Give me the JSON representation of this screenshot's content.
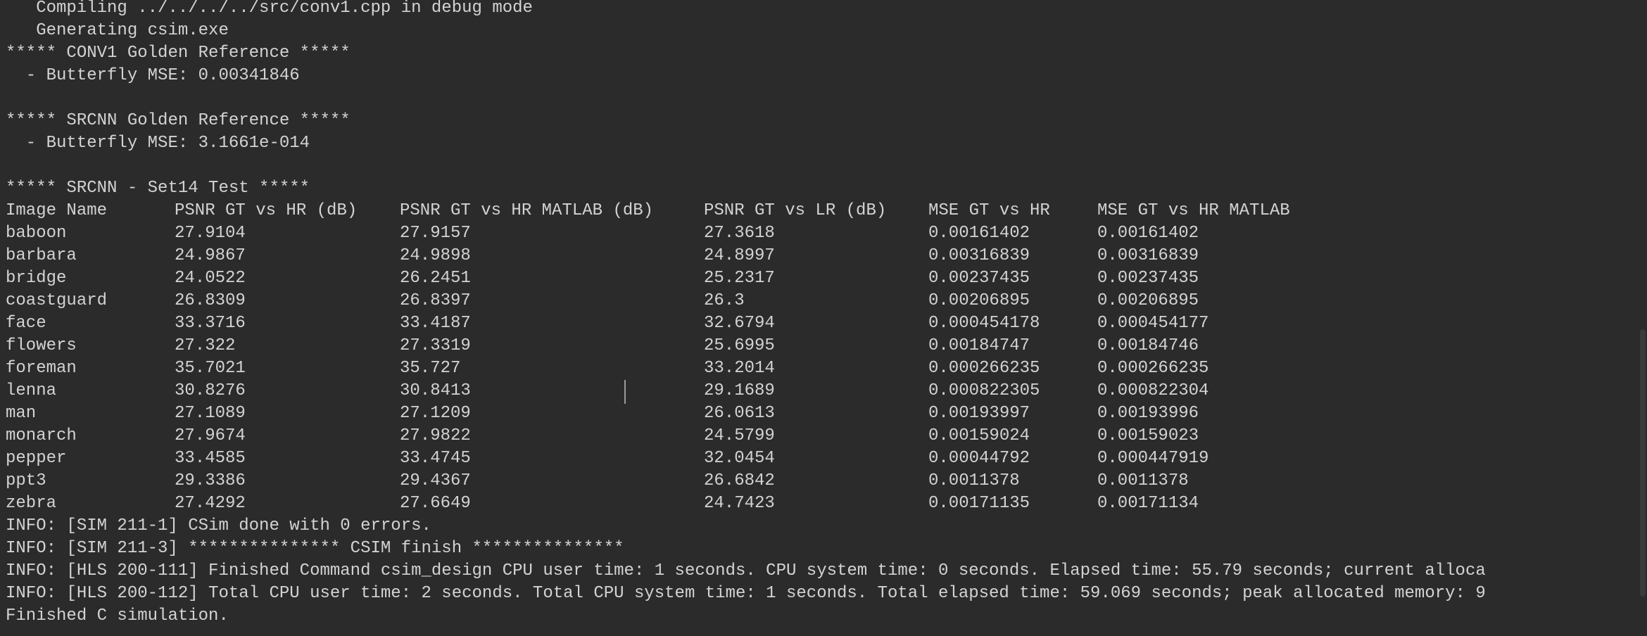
{
  "console": {
    "lines_top": [
      "   Compiling ../../../../src/conv1.cpp in debug mode",
      "   Generating csim.exe",
      "***** CONV1 Golden Reference *****",
      "  - Butterfly MSE: 0.00341846",
      "",
      "***** SRCNN Golden Reference *****",
      "  - Butterfly MSE: 3.1661e-014",
      "",
      "***** SRCNN - Set14 Test *****"
    ],
    "table": {
      "headers": [
        "Image Name",
        "PSNR GT vs HR (dB)",
        "PSNR GT vs HR MATLAB (dB)",
        "PSNR GT vs LR (dB)",
        "MSE GT vs HR",
        "MSE GT vs HR MATLAB"
      ],
      "rows": [
        [
          "baboon",
          "27.9104",
          "27.9157",
          "27.3618",
          "0.00161402",
          "0.00161402"
        ],
        [
          "barbara",
          "24.9867",
          "24.9898",
          "24.8997",
          "0.00316839",
          "0.00316839"
        ],
        [
          "bridge",
          "24.0522",
          "26.2451",
          "25.2317",
          "0.00237435",
          "0.00237435"
        ],
        [
          "coastguard",
          "26.8309",
          "26.8397",
          "26.3",
          "0.00206895",
          "0.00206895"
        ],
        [
          "face",
          "33.3716",
          "33.4187",
          "32.6794",
          "0.000454178",
          "0.000454177"
        ],
        [
          "flowers",
          "27.322",
          "27.3319",
          "25.6995",
          "0.00184747",
          "0.00184746"
        ],
        [
          "foreman",
          "35.7021",
          "35.727",
          "33.2014",
          "0.000266235",
          "0.000266235"
        ],
        [
          "lenna",
          "30.8276",
          "30.8413",
          "29.1689",
          "0.000822305",
          "0.000822304"
        ],
        [
          "man",
          "27.1089",
          "27.1209",
          "26.0613",
          "0.00193997",
          "0.00193996"
        ],
        [
          "monarch",
          "27.9674",
          "27.9822",
          "24.5799",
          "0.00159024",
          "0.00159023"
        ],
        [
          "pepper",
          "33.4585",
          "33.4745",
          "32.0454",
          "0.00044792",
          "0.000447919"
        ],
        [
          "ppt3",
          "29.3386",
          "29.4367",
          "26.6842",
          "0.0011378",
          "0.0011378"
        ],
        [
          "zebra",
          "27.4292",
          "27.6649",
          "24.7423",
          "0.00171135",
          "0.00171134"
        ]
      ]
    },
    "lines_bottom": [
      "INFO: [SIM 211-1] CSim done with 0 errors.",
      "INFO: [SIM 211-3] *************** CSIM finish ***************",
      "INFO: [HLS 200-111] Finished Command csim_design CPU user time: 1 seconds. CPU system time: 0 seconds. Elapsed time: 55.79 seconds; current alloca",
      "INFO: [HLS 200-112] Total CPU user time: 2 seconds. Total CPU system time: 1 seconds. Total elapsed time: 59.069 seconds; peak allocated memory: 9",
      "Finished C simulation."
    ]
  }
}
